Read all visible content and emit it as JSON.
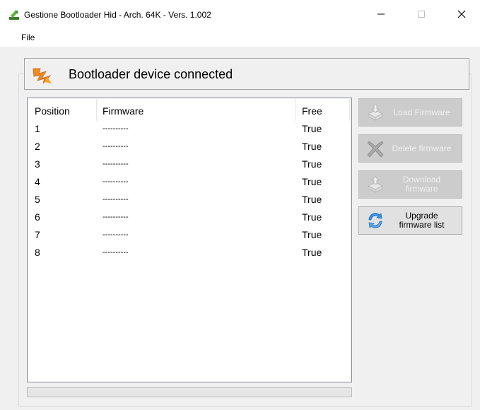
{
  "window": {
    "title": "Gestione Bootloader Hid - Arch. 64K - Vers. 1.002",
    "app_icon": "arrow-down-green-icon"
  },
  "menu": {
    "file_label": "File"
  },
  "status": {
    "icon": "lightning-orange-icon",
    "text": "Bootloader device connected"
  },
  "list": {
    "columns": [
      "Position",
      "Firmware",
      "Free"
    ],
    "rows": [
      {
        "position": "1",
        "firmware": "----------",
        "free": "True"
      },
      {
        "position": "2",
        "firmware": "----------",
        "free": "True"
      },
      {
        "position": "3",
        "firmware": "----------",
        "free": "True"
      },
      {
        "position": "4",
        "firmware": "----------",
        "free": "True"
      },
      {
        "position": "5",
        "firmware": "----------",
        "free": "True"
      },
      {
        "position": "6",
        "firmware": "----------",
        "free": "True"
      },
      {
        "position": "7",
        "firmware": "----------",
        "free": "True"
      },
      {
        "position": "8",
        "firmware": "----------",
        "free": "True"
      }
    ]
  },
  "buttons": {
    "load": {
      "label": "Load Firmware",
      "icon": "load-firmware-icon",
      "enabled": false
    },
    "delete": {
      "label": "Delete firmware",
      "icon": "delete-x-icon",
      "enabled": false
    },
    "download_line1": "Download",
    "download_line2": "firmware",
    "download_icon": "download-firmware-icon",
    "upgrade_line1": "Upgrade",
    "upgrade_line2": "firmware list",
    "upgrade_icon": "refresh-arrows-icon"
  },
  "progress": {
    "value": 0
  },
  "colors": {
    "accent_orange": "#f08a1c",
    "refresh_blue": "#3a8ee6",
    "disabled_button": "#cccccc"
  }
}
